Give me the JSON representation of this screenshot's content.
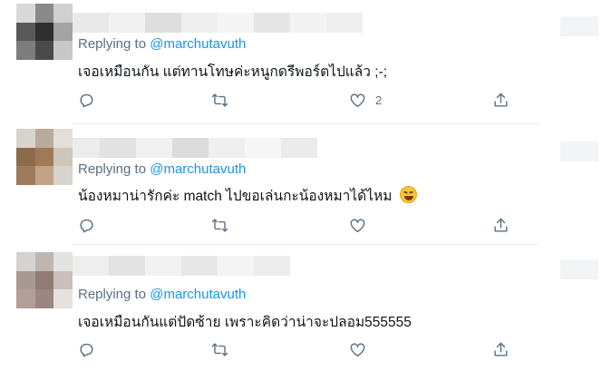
{
  "replies": [
    {
      "replying_prefix": "Replying to",
      "handle": "@marchutavuth",
      "text": "เจอเหมือนกัน แต่ทานโทษค่ะหนูกดรีพอร์ตไปแล้ว ;-;",
      "like_count": "2",
      "has_emoji": false
    },
    {
      "replying_prefix": "Replying to",
      "handle": "@marchutavuth",
      "text": "น้องหมาน่ารักค่ะ match ไปขอเล่นกะน้องหมาได้ไหม",
      "like_count": "",
      "has_emoji": true,
      "emoji_name": "grinning-squinting-face-emoji"
    },
    {
      "replying_prefix": "Replying to",
      "handle": "@marchutavuth",
      "text": "เจอเหมือนกันแต่ปัดซ้าย เพราะคิดว่าน่าจะปลอม555555",
      "like_count": "",
      "has_emoji": false
    }
  ],
  "icons": {
    "reply": "reply-icon",
    "retweet": "retweet-icon",
    "like": "like-icon",
    "share": "share-icon"
  },
  "colors": {
    "link": "#1b95e0",
    "muted": "#5b7083",
    "text": "#0f1419",
    "divider": "#e6ecf0"
  }
}
